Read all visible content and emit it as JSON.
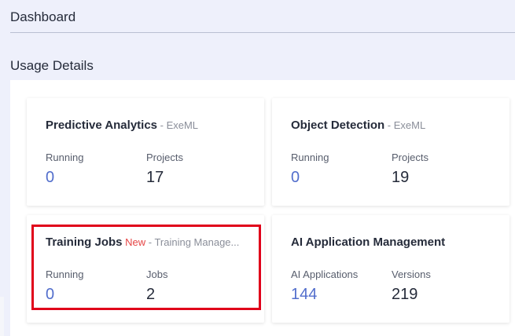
{
  "header": {
    "title": "Dashboard"
  },
  "section": {
    "title": "Usage Details"
  },
  "cards": [
    {
      "title": "Predictive Analytics",
      "subtitle": " - ExeML",
      "metrics": [
        {
          "label": "Running",
          "value": "0"
        },
        {
          "label": "Projects",
          "value": "17"
        }
      ]
    },
    {
      "title": "Object Detection",
      "subtitle": " - ExeML",
      "metrics": [
        {
          "label": "Running",
          "value": "0"
        },
        {
          "label": "Projects",
          "value": "19"
        }
      ]
    },
    {
      "title": "Training Jobs",
      "badge": " New",
      "subtitle": " - Training Manage...",
      "metrics": [
        {
          "label": "Running",
          "value": "0"
        },
        {
          "label": "Jobs",
          "value": "2"
        }
      ]
    },
    {
      "title": "AI Application Management",
      "metrics": [
        {
          "label": "AI Applications",
          "value": "144"
        },
        {
          "label": "Versions",
          "value": "219"
        }
      ]
    }
  ],
  "colors": {
    "link": "#526ecc",
    "badge": "#e54545",
    "highlight": "#e0001a",
    "background": "#eef0fb"
  }
}
